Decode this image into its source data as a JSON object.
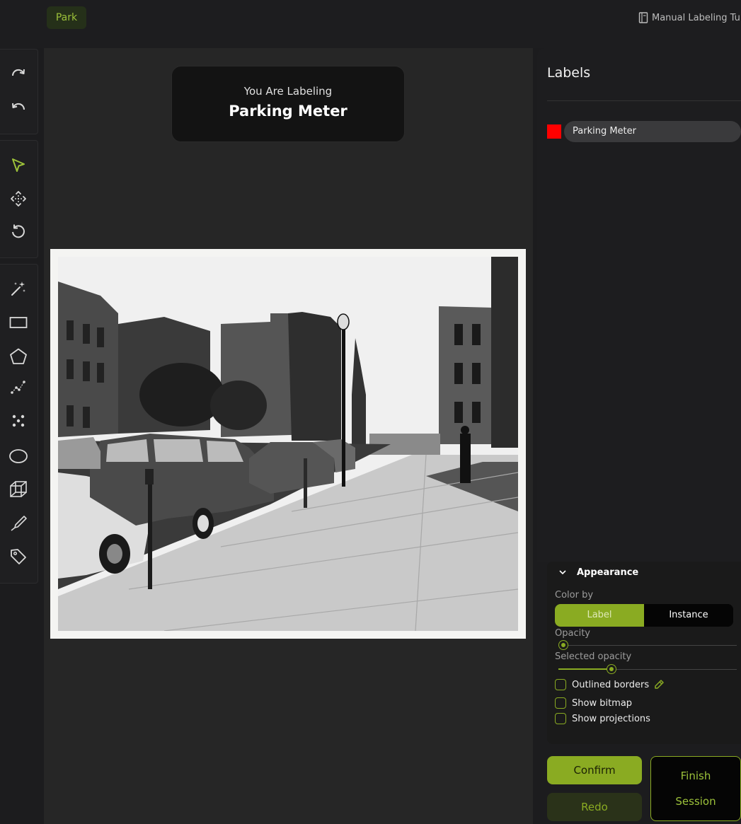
{
  "header": {
    "project_chip": "Park",
    "tutorial_link": "Manual Labeling Tu"
  },
  "toolbar": {
    "history": [
      {
        "name": "redo-icon",
        "interactable": true
      },
      {
        "name": "undo-icon",
        "interactable": true
      }
    ],
    "navigation": [
      {
        "name": "select-cursor-icon",
        "interactable": true,
        "active": true
      },
      {
        "name": "move-icon",
        "interactable": true
      },
      {
        "name": "reset-view-icon",
        "interactable": true
      }
    ],
    "annotation": [
      {
        "name": "magic-wand-icon"
      },
      {
        "name": "rectangle-icon"
      },
      {
        "name": "polygon-icon"
      },
      {
        "name": "polyline-icon"
      },
      {
        "name": "points-icon"
      },
      {
        "name": "ellipse-icon"
      },
      {
        "name": "cuboid-icon"
      },
      {
        "name": "brush-icon"
      },
      {
        "name": "tag-icon"
      }
    ]
  },
  "canvas": {
    "card_subtitle": "You Are Labeling",
    "card_title": "Parking Meter",
    "image_description": "black-and-white street photo with parked vintage cars"
  },
  "labels": {
    "title": "Labels",
    "items": [
      {
        "name": "Parking Meter",
        "color": "#ff0000"
      }
    ]
  },
  "appearance": {
    "title": "Appearance",
    "color_by_label": "Color by",
    "color_by_options": [
      "Label",
      "Instance"
    ],
    "color_by_selected": "Label",
    "opacity_label": "Opacity",
    "opacity_value": 0.05,
    "selected_opacity_label": "Selected opacity",
    "selected_opacity_value": 0.3,
    "checkboxes": [
      {
        "label": "Outlined borders",
        "checked": false,
        "icon": "eyedropper-icon"
      },
      {
        "label": "Show bitmap",
        "checked": false
      },
      {
        "label": "Show projections",
        "checked": false
      }
    ]
  },
  "actions": {
    "confirm": "Confirm",
    "redo": "Redo",
    "finish_line1": "Finish",
    "finish_line2": "Session"
  },
  "colors": {
    "accent": "#8aab22",
    "background": "#1c1c1e",
    "label_red": "#ff0000"
  }
}
